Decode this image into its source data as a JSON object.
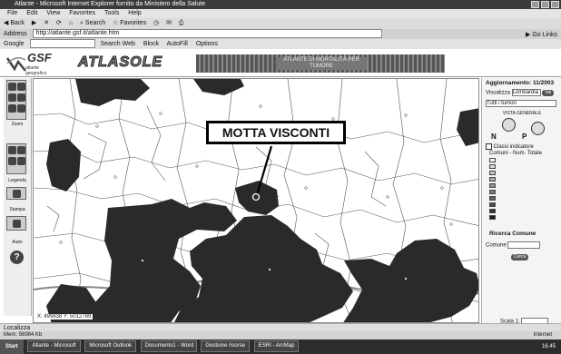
{
  "window": {
    "title": "Atlante - Microsoft Internet Explorer fornito da Ministero della Salute"
  },
  "menu": [
    "File",
    "Edit",
    "View",
    "Favorites",
    "Tools",
    "Help"
  ],
  "toolbar": [
    "Back",
    "Search",
    "Favorites"
  ],
  "address": {
    "label": "Address",
    "value": "http://atlante.gsf.it/atlante.htm",
    "go": "Go",
    "links": "Links"
  },
  "google": {
    "label": "Google",
    "items": [
      "Search Web",
      "Block",
      "AutoFill",
      "Options"
    ]
  },
  "header": {
    "logo": "GSF",
    "logo_tag": "atlante geografico",
    "title": "ATLASOLE",
    "banner": "ATLANTE DI MORTALITÀ PER TUMORE"
  },
  "leftpanel": {
    "labels": [
      "Zoom",
      "Legenda",
      "Stampa",
      "Aiuto"
    ]
  },
  "map": {
    "callout": "MOTTA VISCONTI",
    "coords": "X: 499838  Y: 5012789"
  },
  "rightpanel": {
    "title": "Aggiornamento: 11/2003",
    "region_label": "Visualizza",
    "region_value": "Lombardia",
    "go_label": "Vai",
    "select2": "Tutti i tumori",
    "section1": "VISTA GENERALE",
    "compass_n": "N",
    "compass_p": "P",
    "legend_title": "Comuni - Num. Totale",
    "legend_check": "Classi indicatore",
    "search_title": "Ricerca Comune",
    "search_label": "Comune",
    "search_btn": "Cerca",
    "scale_label": "Scala 1:"
  },
  "status": {
    "text": "Localizza",
    "zone": "Internet",
    "mem": "Mem: 56984 Kb"
  },
  "taskbar": {
    "start": "Start",
    "clock": "16.45",
    "tasks": [
      "Atlante - Microsoft",
      "Microsoft Outlook",
      "Documento1 - Word",
      "Gestione risorse",
      "ESRI - ArcMap"
    ]
  },
  "colors": {
    "region_fill": "#2a2a2a",
    "map_bg": "#ffffff",
    "border": "#888888"
  }
}
